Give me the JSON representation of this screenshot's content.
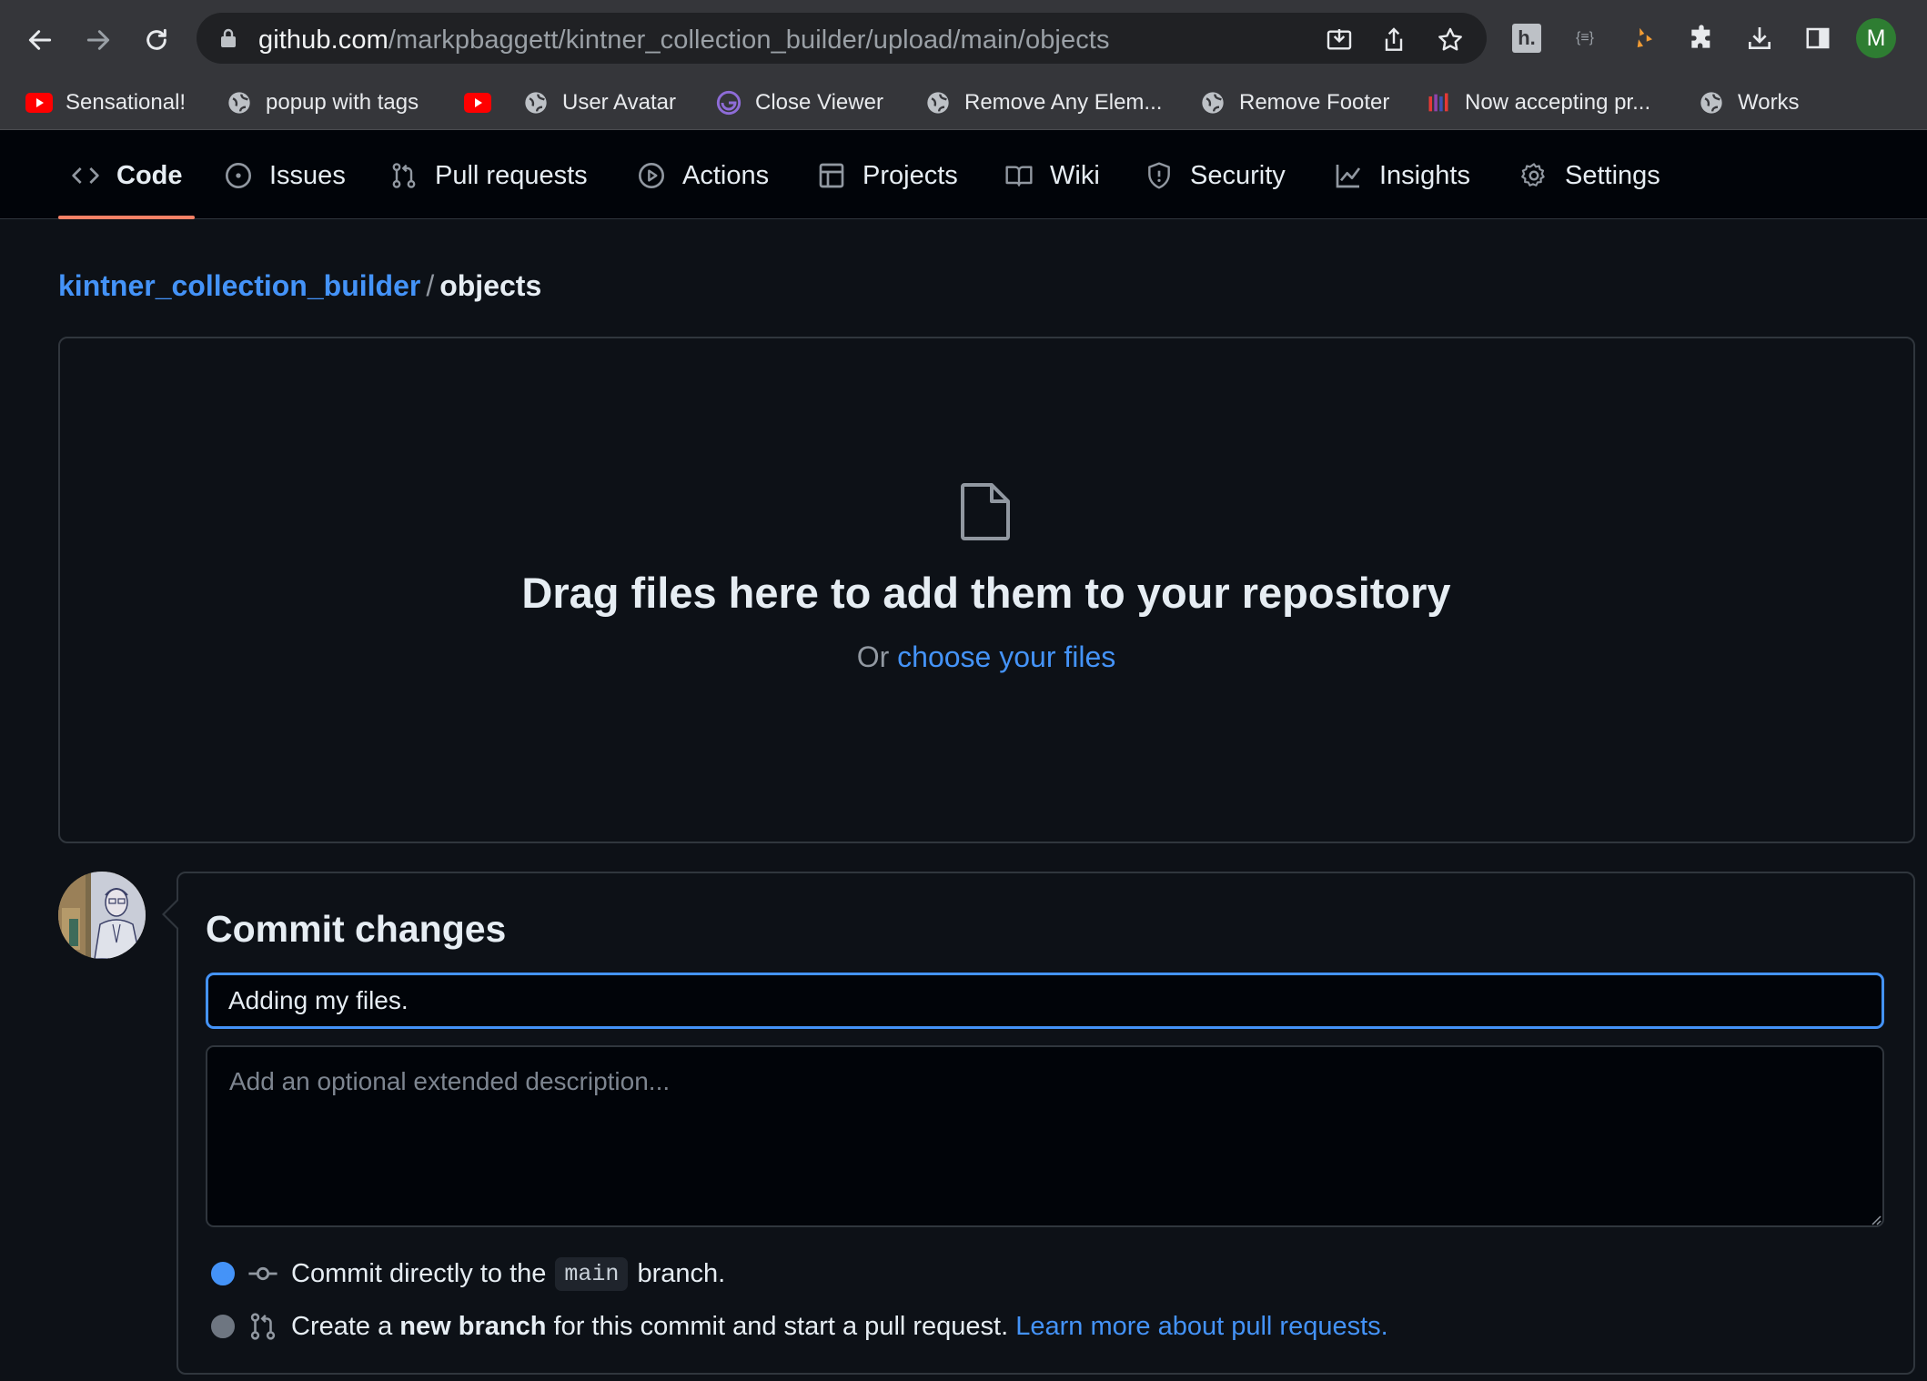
{
  "browser": {
    "url_host": "github.com",
    "url_path": "/markpbaggett/kintner_collection_builder/upload/main/objects",
    "profile_initial": "M",
    "bookmarks": [
      {
        "label": "Sensational!",
        "icon": "youtube-icon"
      },
      {
        "label": "popup with tags",
        "icon": "globe-icon"
      },
      {
        "label": "",
        "icon": "youtube-icon"
      },
      {
        "label": "User Avatar",
        "icon": "globe-icon"
      },
      {
        "label": "Close Viewer",
        "icon": "gatsby-icon"
      },
      {
        "label": "Remove Any Elem...",
        "icon": "globe-icon"
      },
      {
        "label": "Remove Footer",
        "icon": "globe-icon"
      },
      {
        "label": "Now accepting pr...",
        "icon": "library-icon"
      },
      {
        "label": "Works",
        "icon": "globe-icon"
      }
    ],
    "extension_labels": {
      "hypothesis": "h.",
      "json_viewer": "{≡}"
    }
  },
  "repo_nav": {
    "tabs": [
      {
        "label": "Code",
        "icon": "code-icon",
        "selected": true
      },
      {
        "label": "Issues",
        "icon": "issue-icon"
      },
      {
        "label": "Pull requests",
        "icon": "pull-request-icon"
      },
      {
        "label": "Actions",
        "icon": "play-icon"
      },
      {
        "label": "Projects",
        "icon": "table-icon"
      },
      {
        "label": "Wiki",
        "icon": "book-icon"
      },
      {
        "label": "Security",
        "icon": "shield-icon"
      },
      {
        "label": "Insights",
        "icon": "graph-icon"
      },
      {
        "label": "Settings",
        "icon": "gear-icon"
      }
    ]
  },
  "breadcrumb": {
    "repo": "kintner_collection_builder",
    "separator": "/",
    "dir": "objects"
  },
  "dropzone": {
    "title": "Drag files here to add them to your repository",
    "prefix": "Or",
    "link": "choose your files"
  },
  "commit": {
    "title": "Commit changes",
    "summary_value": "Adding my files.",
    "description_placeholder": "Add an optional extended description...",
    "option_direct": {
      "before": "Commit directly to the",
      "branch": "main",
      "after": "branch.",
      "selected": true
    },
    "option_branch": {
      "before": "Create a",
      "bold": "new branch",
      "middle": "for this commit and start a pull request.",
      "link": "Learn more about pull requests.",
      "selected": false
    }
  },
  "colors": {
    "background": "#0d1117",
    "link": "#4493f8",
    "selected_tab_underline": "#f78166",
    "border": "#30363d"
  }
}
